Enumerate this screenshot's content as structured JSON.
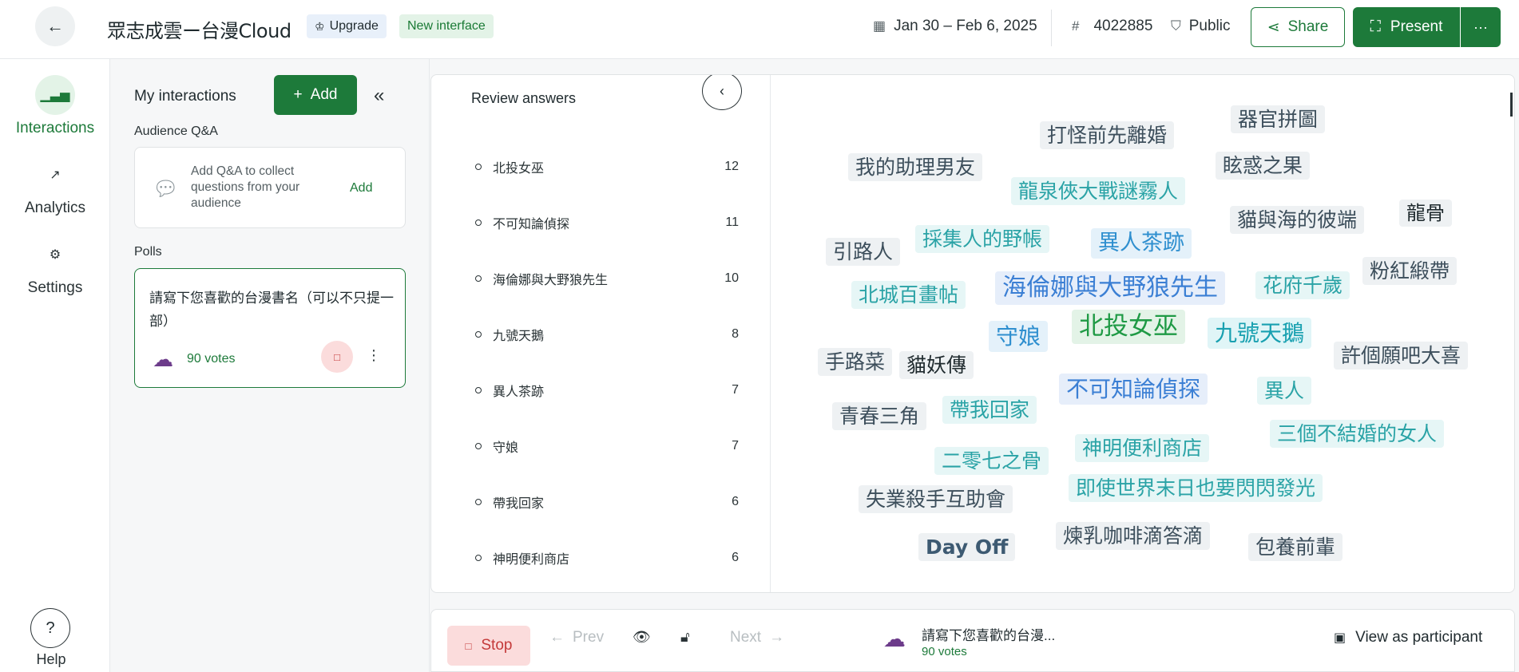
{
  "header": {
    "back_icon": "arrow-left-icon",
    "title": "眾志成雲ー台漫Cloud",
    "upgrade_label": "Upgrade",
    "new_interface_label": "New interface",
    "date_range": "Jan 30 – Feb 6, 2025",
    "code_prefix": "#",
    "code": "4022885",
    "visibility": "Public",
    "share_label": "Share",
    "present_label": "Present",
    "more_label": "···"
  },
  "rail": {
    "interactions": "Interactions",
    "analytics": "Analytics",
    "settings": "Settings",
    "help_symbol": "?",
    "help": "Help"
  },
  "panel": {
    "title": "My interactions",
    "add_label": "Add",
    "qa_section": "Audience Q&A",
    "qa_text": "Add Q&A to collect questions from your audience",
    "qa_add": "Add",
    "polls_section": "Polls",
    "poll_question": "請寫下您喜歡的台漫書名（可以不只提一部）",
    "poll_votes": "90 votes"
  },
  "review": {
    "title": "Review answers",
    "answers": [
      {
        "text": "北投女巫",
        "count": "12"
      },
      {
        "text": "不可知論偵探",
        "count": "11"
      },
      {
        "text": "海倫娜與大野狼先生",
        "count": "10"
      },
      {
        "text": "九號天鵝",
        "count": "8"
      },
      {
        "text": "異人茶跡",
        "count": "7"
      },
      {
        "text": "守娘",
        "count": "7"
      },
      {
        "text": "帶我回家",
        "count": "6"
      },
      {
        "text": "神明便利商店",
        "count": "6"
      }
    ]
  },
  "cloud": {
    "words": [
      {
        "text": "器官拼圖",
        "color": "#3d4f5c",
        "bg": "#eef1f3"
      },
      {
        "text": "打怪前先離婚",
        "color": "#3d4f5c",
        "bg": "#eef1f3"
      },
      {
        "text": "眩惑之果",
        "color": "#3d4f5c",
        "bg": "#eef1f3"
      },
      {
        "text": "我的助理男友",
        "color": "#3d4f5c",
        "bg": "#eef1f3"
      },
      {
        "text": "龍泉俠大戰謎霧人",
        "color": "#2aa3a6",
        "bg": "#e6f6f6"
      },
      {
        "text": "龍骨",
        "color": "#1f2a2e",
        "bg": "#eef1f3"
      },
      {
        "text": "貓與海的彼端",
        "color": "#3d4f5c",
        "bg": "#eef1f3"
      },
      {
        "text": "採集人的野帳",
        "color": "#2aa3a6",
        "bg": "#e6f6f6"
      },
      {
        "text": "異人茶跡",
        "color": "#2f8fcf",
        "bg": "#e4f1fa"
      },
      {
        "text": "引路人",
        "color": "#3d4f5c",
        "bg": "#eef1f3"
      },
      {
        "text": "粉紅緞帶",
        "color": "#3d4f5c",
        "bg": "#eef1f3"
      },
      {
        "text": "海倫娜與大野狼先生",
        "color": "#3b7fd4",
        "bg": "#e6eefa"
      },
      {
        "text": "花府千歲",
        "color": "#2aa3a6",
        "bg": "#e6f6f6"
      },
      {
        "text": "北城百畫帖",
        "color": "#2aa3a6",
        "bg": "#e6f6f6"
      },
      {
        "text": "北投女巫",
        "color": "#1f9a45",
        "bg": "#e3f3e7"
      },
      {
        "text": "九號天鵝",
        "color": "#18a0b0",
        "bg": "#e0f5f7"
      },
      {
        "text": "守娘",
        "color": "#2f8fcf",
        "bg": "#e4f1fa"
      },
      {
        "text": "許個願吧大喜",
        "color": "#3d4f5c",
        "bg": "#eef1f3"
      },
      {
        "text": "手路菜",
        "color": "#3d4f5c",
        "bg": "#eef1f3"
      },
      {
        "text": "貓妖傳",
        "color": "#1f2a2e",
        "bg": "#eef1f3"
      },
      {
        "text": "不可知論偵探",
        "color": "#3b7fd4",
        "bg": "#e6eefa"
      },
      {
        "text": "異人",
        "color": "#2aa3a6",
        "bg": "#e6f6f6"
      },
      {
        "text": "青春三角",
        "color": "#3d4f5c",
        "bg": "#eef1f3"
      },
      {
        "text": "帶我回家",
        "color": "#2aa3a6",
        "bg": "#e6f6f6"
      },
      {
        "text": "三個不結婚的女人",
        "color": "#2aa3a6",
        "bg": "#e6f6f6"
      },
      {
        "text": "神明便利商店",
        "color": "#2aa3a6",
        "bg": "#e6f6f6"
      },
      {
        "text": "二零七之骨",
        "color": "#2aa3a6",
        "bg": "#e6f6f6"
      },
      {
        "text": "即使世界末日也要閃閃發光",
        "color": "#2aa3a6",
        "bg": "#e6f6f6"
      },
      {
        "text": "失業殺手互助會",
        "color": "#3d4f5c",
        "bg": "#eef1f3"
      },
      {
        "text": "煉乳咖啡滴答滴",
        "color": "#3d4f5c",
        "bg": "#eef1f3"
      },
      {
        "text": "Day Off",
        "color": "#3d5a72",
        "bg": "#eef1f3"
      },
      {
        "text": "包養前輩",
        "color": "#3d4f5c",
        "bg": "#eef1f3"
      }
    ]
  },
  "bottombar": {
    "stop_label": "Stop",
    "prev_label": "Prev",
    "next_label": "Next",
    "poll_question_short": "請寫下您喜歡的台漫...",
    "poll_votes": "90 votes",
    "view_as_participant": "View as participant"
  }
}
